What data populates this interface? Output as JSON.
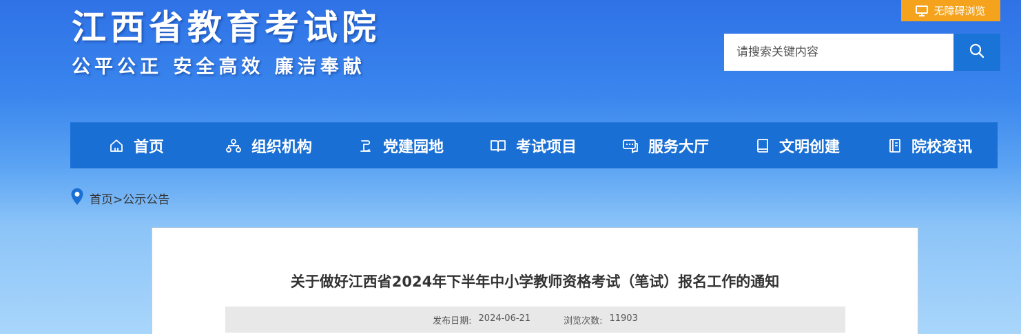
{
  "header": {
    "title": "江西省教育考试院",
    "slogan": "公平公正 安全高效 廉洁奉献",
    "accessibility_label": "无障碍浏览",
    "search_placeholder": "请搜索关键内容"
  },
  "nav": {
    "items": [
      {
        "label": "首页",
        "icon": "home-icon"
      },
      {
        "label": "组织机构",
        "icon": "org-chart-icon"
      },
      {
        "label": "党建园地",
        "icon": "party-building-icon"
      },
      {
        "label": "考试项目",
        "icon": "book-open-icon"
      },
      {
        "label": "服务大厅",
        "icon": "service-chat-icon"
      },
      {
        "label": "文明创建",
        "icon": "book-icon"
      },
      {
        "label": "院校资讯",
        "icon": "document-icon"
      }
    ]
  },
  "breadcrumb": {
    "home": "首页",
    "separator": ">",
    "current": "公示公告"
  },
  "article": {
    "title": "关于做好江西省2024年下半年中小学教师资格考试（笔试）报名工作的通知",
    "date_label": "发布日期:",
    "date": "2024-06-21",
    "views_label": "浏览次数:",
    "views": "11903"
  },
  "colors": {
    "nav_background": "#1a6fd4",
    "accessibility_button": "#f5a21c",
    "search_button": "#1a73d6"
  }
}
